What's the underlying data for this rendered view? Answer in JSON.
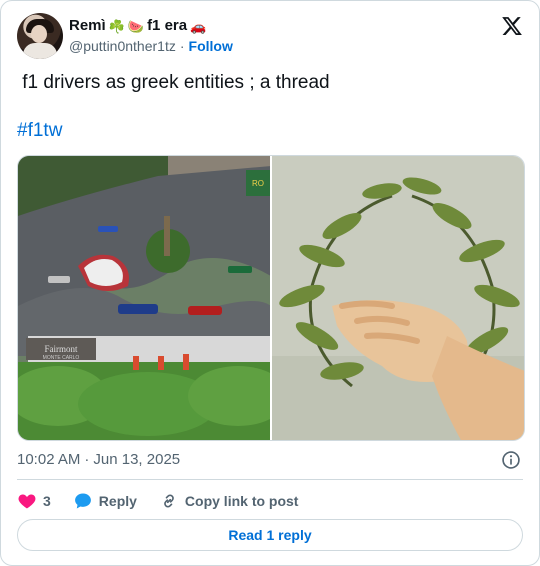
{
  "author": {
    "display_name": "Remì",
    "name_suffix": "f1 era",
    "emojis": [
      "☘️",
      "🍉",
      "🚗"
    ],
    "handle": "@puttin0nther1tz",
    "separator": "·",
    "follow_label": "Follow"
  },
  "tweet": {
    "text": "󠁧 f1 drivers as greek entities ; a thread",
    "hashtag": "#f1tw"
  },
  "meta": {
    "time": "10:02 AM",
    "separator": "·",
    "date": "Jun 13, 2025"
  },
  "actions": {
    "like_count": "3",
    "reply_label": "Reply",
    "copy_label": "Copy link to post"
  },
  "read_replies_label": "Read 1 reply",
  "photo_texts": {
    "sign_text": "Fairmont",
    "sign_subtext": "MONTE CARLO",
    "banner_text": "RO"
  },
  "colors": {
    "accent": "#006fd6",
    "like_red": "#f91880",
    "reply_blue": "#1d9bf0",
    "muted": "#536471"
  },
  "icons": {
    "brand": "x-logo-icon",
    "info": "info-icon",
    "like": "heart-icon",
    "reply": "speech-bubble-icon",
    "copy": "link-icon"
  }
}
